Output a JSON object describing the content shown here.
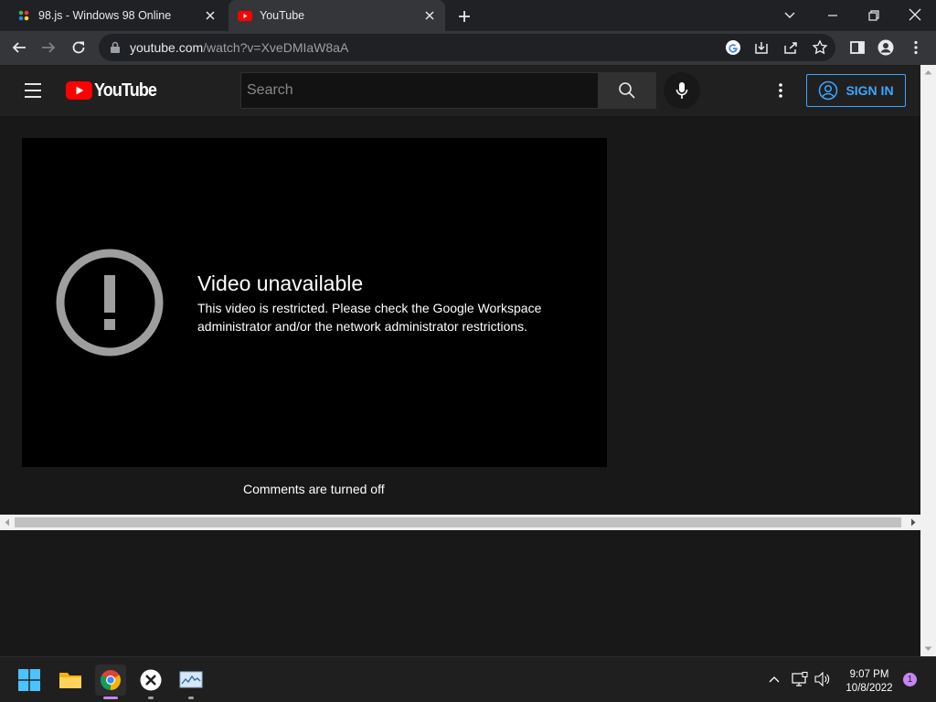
{
  "browser": {
    "tabs": [
      {
        "title": "98.js - Windows 98 Online"
      },
      {
        "title": "YouTube"
      }
    ],
    "url_host": "youtube.com",
    "url_path": "/watch?v=XveDMIaW8aA"
  },
  "youtube": {
    "logo_text": "YouTube",
    "search_placeholder": "Search",
    "sign_in_label": "SIGN IN",
    "error_title": "Video unavailable",
    "error_message": "This video is restricted. Please check the Google Workspace administrator and/or the network administrator restrictions.",
    "comments_text": "Comments are turned off"
  },
  "taskbar": {
    "time": "9:07 PM",
    "date": "10/8/2022",
    "notification_count": "1"
  },
  "colors": {
    "accent_blue": "#3ea6ff",
    "youtube_red": "#ff0000"
  }
}
